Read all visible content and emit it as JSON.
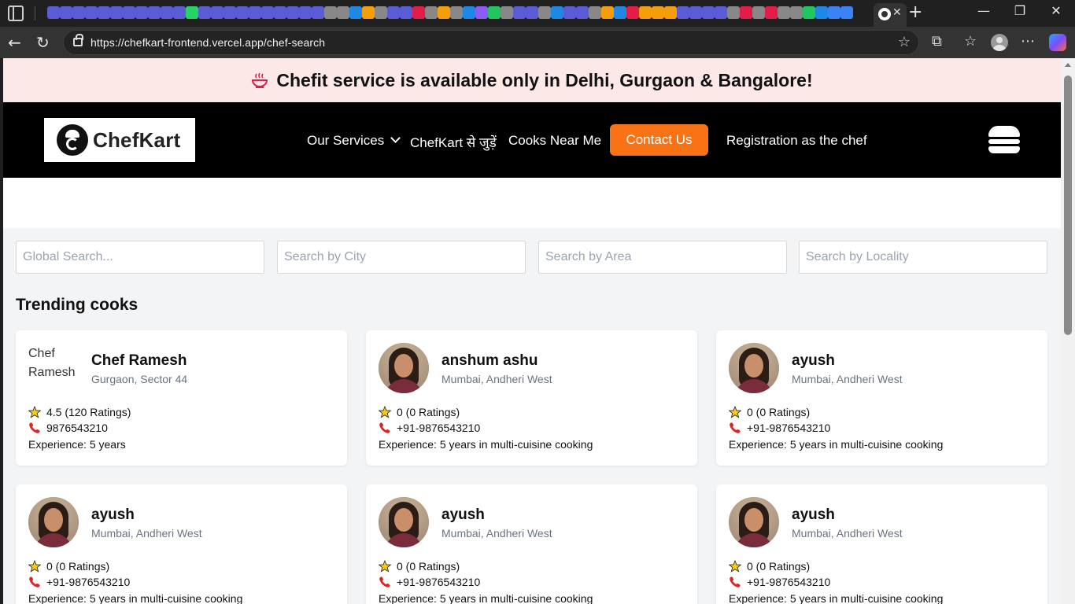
{
  "browser": {
    "url": "https://chefkart-frontend.vercel.app/chef-search",
    "new_tab_label": "+",
    "tab_close_label": "✕",
    "window_controls": {
      "minimize": "—",
      "maximize": "❐",
      "close": "✕"
    }
  },
  "announcement": {
    "text": "Chefit service is available only in Delhi, Gurgaon & Bangalore!",
    "accent_color": "#e11d48"
  },
  "navbar": {
    "logo_text": "ChefKart",
    "links": [
      {
        "label": "Our Services"
      },
      {
        "label": "ChefKart से जुड़ें"
      },
      {
        "label": "Cooks Near Me"
      }
    ],
    "contact_label": "Contact Us",
    "registration_label": "Registration as the chef",
    "accent_color": "#f97316"
  },
  "search": {
    "global_placeholder": "Global Search...",
    "city_placeholder": "Search by City",
    "area_placeholder": "Search by Area",
    "locality_placeholder": "Search by Locality"
  },
  "section_title": "Trending cooks",
  "cooks": [
    {
      "name": "Chef Ramesh",
      "location": "Gurgaon, Sector 44",
      "rating": "4.5 (120 Ratings)",
      "phone": "9876543210",
      "experience": "Experience: 5 years",
      "image_alt": "Chef Ramesh",
      "image_broken": true
    },
    {
      "name": "anshum ashu",
      "location": "Mumbai, Andheri West",
      "rating": "0 (0 Ratings)",
      "phone": "+91-9876543210",
      "experience": "Experience: 5 years in multi-cuisine cooking",
      "image_broken": false
    },
    {
      "name": "ayush",
      "location": "Mumbai, Andheri West",
      "rating": "0 (0 Ratings)",
      "phone": "+91-9876543210",
      "experience": "Experience: 5 years in multi-cuisine cooking",
      "image_broken": false
    },
    {
      "name": "ayush",
      "location": "Mumbai, Andheri West",
      "rating": "0 (0 Ratings)",
      "phone": "+91-9876543210",
      "experience": "Experience: 5 years in multi-cuisine cooking",
      "image_broken": false
    },
    {
      "name": "ayush",
      "location": "Mumbai, Andheri West",
      "rating": "0 (0 Ratings)",
      "phone": "+91-9876543210",
      "experience": "Experience: 5 years in multi-cuisine cooking",
      "image_broken": false
    },
    {
      "name": "ayush",
      "location": "Mumbai, Andheri West",
      "rating": "0 (0 Ratings)",
      "phone": "+91-9876543210",
      "experience": "Experience: 5 years in multi-cuisine cooking",
      "image_broken": false
    }
  ]
}
